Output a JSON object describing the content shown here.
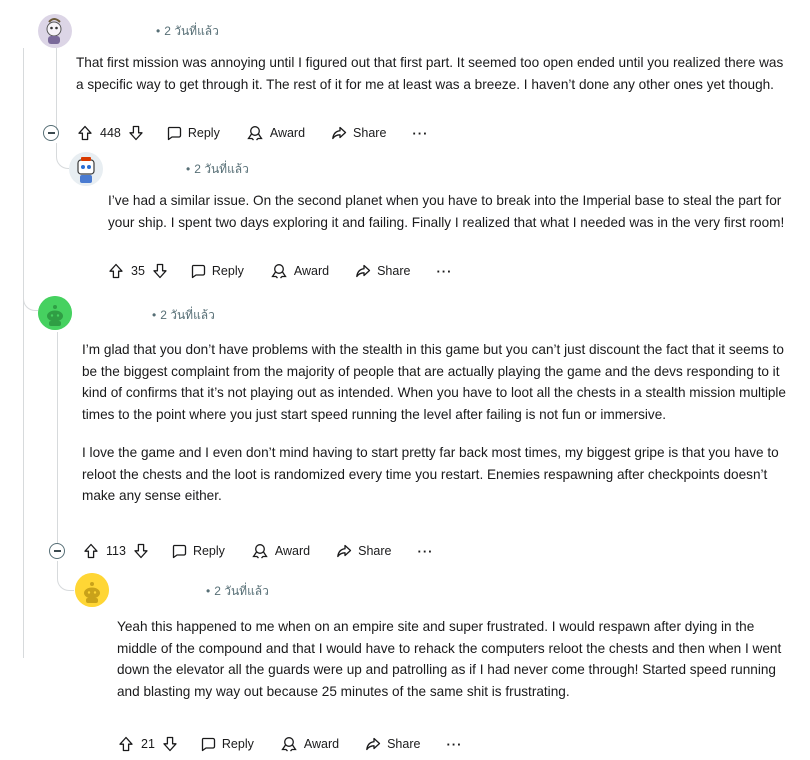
{
  "colors": {
    "thread_line": "#d7dadc",
    "meta_text": "#576f76",
    "avatar_green": "#46d160",
    "avatar_yellow": "#ffd635"
  },
  "comments": [
    {
      "time": "2 วันที่แล้ว",
      "avatar_icon": "cartoon-character-avatar-icon",
      "paragraphs": [
        "That first mission was annoying until I figured out that first part. It seemed too open ended until you realized there was a specific way to get through it. The rest of it for me at least was a breeze. I haven’t done any other ones yet though."
      ],
      "votes": "448",
      "reply_label": "Reply",
      "award_label": "Award",
      "share_label": "Share",
      "more_label": "···"
    },
    {
      "time": "2 วันที่แล้ว",
      "avatar_icon": "robot-avatar-icon",
      "paragraphs": [
        "I’ve had a similar issue. On the second planet when you have to break into the Imperial base to steal the part for your ship. I spent two days exploring it and failing. Finally I realized that what I needed was in the very first room!"
      ],
      "votes": "35",
      "reply_label": "Reply",
      "award_label": "Award",
      "share_label": "Share",
      "more_label": "···"
    },
    {
      "time": "2 วันที่แล้ว",
      "avatar_icon": "snoo-green-avatar-icon",
      "paragraphs": [
        "I’m glad that you don’t have problems with the stealth in this game but you can’t just discount the fact that it seems to be the biggest complaint from the majority of people that are actually playing the game and the devs responding to it kind of confirms that it’s not playing out as intended. When you have to loot all the chests in a stealth mission multiple times to the point where you just start speed running the level after failing is not fun or immersive.",
        "I love the game and I even don’t mind having to start pretty far back most times, my biggest gripe is that you have to reloot the chests and the loot is randomized every time you restart. Enemies respawning after checkpoints doesn’t make any sense either."
      ],
      "votes": "113",
      "reply_label": "Reply",
      "award_label": "Award",
      "share_label": "Share",
      "more_label": "···"
    },
    {
      "time": "2 วันที่แล้ว",
      "avatar_icon": "snoo-yellow-avatar-icon",
      "paragraphs": [
        "Yeah this happened to me when on an empire site and super frustrated. I would respawn after dying in the middle of the compound and that I would have to rehack the computers reloot the chests and then when I went down the elevator all the guards were up and patrolling as if I had never come through! Started speed running and blasting my way out because 25 minutes of the same shit is frustrating."
      ],
      "votes": "21",
      "reply_label": "Reply",
      "award_label": "Award",
      "share_label": "Share",
      "more_label": "···"
    }
  ]
}
